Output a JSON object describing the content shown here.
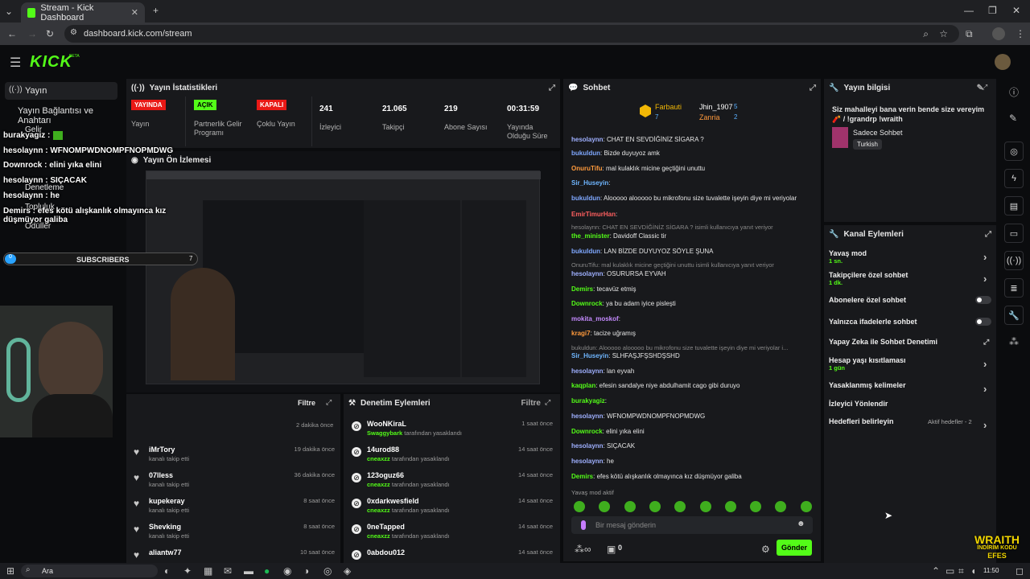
{
  "browser": {
    "tab_title": "Stream - Kick Dashboard",
    "url": "dashboard.kick.com/stream"
  },
  "header": {
    "logo": "KICK",
    "beta": "BETA"
  },
  "sidebar": {
    "items": [
      {
        "label": "Yayın"
      },
      {
        "label": "Yayın Bağlantısı ve Anahtarı"
      },
      {
        "label": "Gelir"
      },
      {
        "label": "Denetleme"
      },
      {
        "label": "Topluluk"
      },
      {
        "label": "Ödüller"
      }
    ]
  },
  "overlay": {
    "lines": [
      {
        "user": "burakyagiz :"
      },
      {
        "user": "hesolaynn :",
        "text": " WFNOMPWDNOMPFNOPMDWG"
      },
      {
        "user": "Downrock",
        "text": " : elini yıka elini"
      },
      {
        "user": "hesolaynn",
        "text": " : SIÇACAK"
      },
      {
        "user": "hesolaynn :",
        "text": " he"
      },
      {
        "user": "Demirs :",
        "text": " efes kötü alışkanlık olmayınca kız düşmüyor galiba"
      }
    ],
    "subscribers_label": "SUBSCRIBERS",
    "subscribers_count": "0",
    "subscribers_goal": "7",
    "brand_top": "WRAITH",
    "brand_mid": "İNDİRİM KODU",
    "brand_bot": "EFES"
  },
  "stats": {
    "title": "Yayın İstatistikleri",
    "live_badge": "YAYINDA",
    "live_label": "Yayın",
    "partner_badge": "AÇIK",
    "partner_label": "Partnerlik Gelir Programı",
    "multi_badge": "KAPALI",
    "multi_label": "Çoklu Yayın",
    "viewers": "241",
    "viewers_label": "İzleyici",
    "followers": "21.065",
    "followers_label": "Takipçi",
    "subs": "219",
    "subs_label": "Abone Sayısı",
    "duration": "00:31:59",
    "duration_label": "Yayında Olduğu Süre"
  },
  "preview": {
    "title": "Yayın Ön İzlemesi"
  },
  "activity": {
    "filter": "Filtre",
    "first_time": "2 dakika önce",
    "rows": [
      {
        "name": "iMrTory",
        "sub": "kanalı takip etti",
        "time": "19 dakika önce"
      },
      {
        "name": "07lless",
        "sub": "kanalı takip etti",
        "time": "36 dakika önce"
      },
      {
        "name": "kupekeray",
        "sub": "kanalı takip etti",
        "time": "8 saat önce"
      },
      {
        "name": "Shevking",
        "sub": "kanalı takip etti",
        "time": "8 saat önce"
      },
      {
        "name": "aliantw77",
        "sub": "",
        "time": "10 saat önce"
      }
    ]
  },
  "moderation": {
    "title": "Denetim Eylemleri",
    "filter": "Filtre",
    "rows": [
      {
        "name": "WooNKiraL",
        "by": "Swaggybark",
        "suffix": " tarafından yasaklandı",
        "time": "1 saat önce"
      },
      {
        "name": "14urod88",
        "by": "cneaxzz",
        "suffix": " tarafından yasaklandı",
        "time": "14 saat önce"
      },
      {
        "name": "123oguz66",
        "by": "cneaxzz",
        "suffix": " tarafından yasaklandı",
        "time": "14 saat önce"
      },
      {
        "name": "0xdarkwesfield",
        "by": "cneaxzz",
        "suffix": " tarafından yasaklandı",
        "time": "14 saat önce"
      },
      {
        "name": "0neTapped",
        "by": "cneaxzz",
        "suffix": " tarafından yasaklandı",
        "time": "14 saat önce"
      },
      {
        "name": "0abdou012",
        "by": "",
        "suffix": "",
        "time": "14 saat önce"
      }
    ]
  },
  "chat": {
    "title": "Sohbet",
    "top1": "Farbauti",
    "top1n": "7",
    "top2": "Jhin_1907",
    "top2n": "5",
    "top3": "Zanria",
    "top3n": "2",
    "messages": [
      {
        "user": "hesolaynn",
        "color": "#9fb0ff",
        "text": ": CHAT EN SEVDİĞİNİZ SİGARA ?"
      },
      {
        "user": "bukuldun",
        "color": "#7fa8ff",
        "text": ": Bizde duyuyoz amk"
      },
      {
        "user": "OnuruTifu",
        "color": "#ff9a3c",
        "text": ": mal kulaklık micine geçtiğini unuttu"
      },
      {
        "user": "Sir_Huseyin",
        "color": "#6fb6ff",
        "text": ":"
      },
      {
        "user": "bukuldun",
        "color": "#7fa8ff",
        "text": ": Alooooo alooooo bu mikrofonu size tuvalette işeyin diye mi veriyolar"
      },
      {
        "user": "EmirTimurHan",
        "color": "#ff5f5f",
        "text": ":"
      },
      {
        "user": "",
        "color": "#888",
        "text": "hesolaynn: CHAT EN SEVDİĞİNİZ SİGARA ? isimli kullanıcıya yanıt veriyor"
      },
      {
        "user": "the_minister",
        "color": "#53fc18",
        "text": ": Davidoff Classic tir"
      },
      {
        "user": "bukuldun",
        "color": "#7fa8ff",
        "text": ": LAN BİZDE DUYUYOZ SÖYLE ŞUNA"
      },
      {
        "user": "",
        "color": "#888",
        "text": "OnuruTifu: mal kulaklık micine geçtiğini unuttu isimli kullanıcıya yanıt veriyor"
      },
      {
        "user": "hesolaynn",
        "color": "#9fb0ff",
        "text": ": OSURURSA EYVAH"
      },
      {
        "user": "Demirs",
        "color": "#53fc18",
        "text": ": tecavüz etmiş"
      },
      {
        "user": "Downrock",
        "color": "#53fc18",
        "text": ": ya bu adam iyice pisleşti"
      },
      {
        "user": "mokita_moskof",
        "color": "#c58bff",
        "text": ":"
      },
      {
        "user": "kragi7",
        "color": "#ff9a3c",
        "text": ": tacize uğramış"
      },
      {
        "user": "",
        "color": "#888",
        "text": "bukuldun: Alooooo alooooo bu mikrofonu size tuvalette işeyin diye mi veriyolar i..."
      },
      {
        "user": "Sir_Huseyin",
        "color": "#6fb6ff",
        "text": ": SLHFAŞJFŞSHDŞSHD"
      },
      {
        "user": "hesolaynn",
        "color": "#9fb0ff",
        "text": ": lan eyvah"
      },
      {
        "user": "kaqplan",
        "color": "#53fc18",
        "text": ": efesin sandalye niye abdulhamit cago gibi duruyo"
      },
      {
        "user": "burakyagiz",
        "color": "#53fc18",
        "text": ":"
      },
      {
        "user": "hesolaynn",
        "color": "#9fb0ff",
        "text": ": WFNOMPWDNOMPFNOPMDWG"
      },
      {
        "user": "Downrock",
        "color": "#53fc18",
        "text": ": elini yıka elini"
      },
      {
        "user": "hesolaynn",
        "color": "#9fb0ff",
        "text": ": SIÇACAK"
      },
      {
        "user": "hesolaynn",
        "color": "#9fb0ff",
        "text": ": he"
      },
      {
        "user": "Demirs",
        "color": "#53fc18",
        "text": ": efes kötü alışkanlık olmayınca kız düşmüyor galiba"
      }
    ],
    "slow_mode": "Yavaş mod aktif",
    "placeholder": "Bir mesaj gönderin",
    "send": "Gönder",
    "counter": "0"
  },
  "info": {
    "title": "Yayın bilgisi",
    "stream_title": "Siz mahalleyi bana verin bende size vereyim 🧨 / !grandrp !wraith",
    "category": "Sadece Sohbet",
    "language": "Turkish"
  },
  "channel_actions": {
    "title": "Kanal Eylemleri",
    "items": [
      {
        "label": "Yavaş mod",
        "sub": "1 sn."
      },
      {
        "label": "Takipçilere özel sohbet",
        "sub": "1 dk."
      },
      {
        "label": "Abonelere özel sohbet",
        "sub": ""
      },
      {
        "label": "Yalnızca ifadelerle sohbet",
        "sub": ""
      },
      {
        "label": "Yapay Zeka ile Sohbet Denetimi",
        "sub": ""
      },
      {
        "label": "Hesap yaşı kısıtlaması",
        "sub": "1 gün"
      },
      {
        "label": "Yasaklanmış kelimeler",
        "sub": ""
      },
      {
        "label": "İzleyici Yönlendir",
        "sub": ""
      },
      {
        "label": "Hedefleri belirleyin",
        "sub": ""
      }
    ],
    "goals_status": "Aktif hedefler - 2"
  },
  "taskbar": {
    "search": "Ara",
    "time": "11:50"
  },
  "colors": {
    "accent": "#53fc18",
    "live": "#e91916",
    "panel": "#18191c"
  }
}
